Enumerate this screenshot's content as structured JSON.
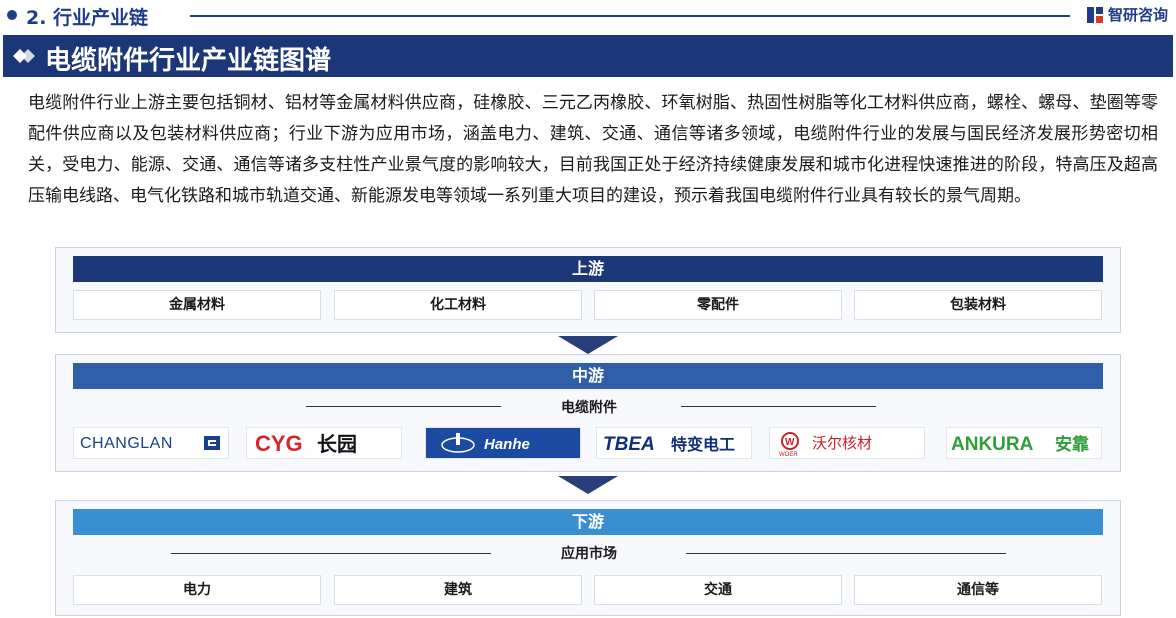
{
  "header": {
    "section": "2. 行业产业链",
    "brand": "智研咨询"
  },
  "title": "电缆附件行业产业链图谱",
  "intro": "电缆附件行业上游主要包括铜材、铝材等金属材料供应商，硅橡胶、三元乙丙橡胶、环氧树脂、热固性树脂等化工材料供应商，螺栓、螺母、垫圈等零配件供应商以及包装材料供应商；行业下游为应用市场，涵盖电力、建筑、交通、通信等诸多领域，电缆附件行业的发展与国民经济发展形势密切相关，受电力、能源、交通、通信等诸多支柱性产业景气度的影响较大，目前我国正处于经济持续健康发展和城市化进程快速推进的阶段，特高压及超高压输电线路、电气化铁路和城市轨道交通、新能源发电等领域一系列重大项目的建设，预示着我国电缆附件行业具有较长的景气周期。",
  "upstream": {
    "label": "上游",
    "items": [
      "金属材料",
      "化工材料",
      "零配件",
      "包装材料"
    ]
  },
  "midstream": {
    "label": "中游",
    "sub": "电缆附件",
    "logos": {
      "changlan": "CHANGLAN",
      "cyg": "CYG",
      "cyg_cn": "长园",
      "hanhe": "Hanhe",
      "tbea": "TBEA",
      "tbea_cn": "特变电工",
      "woer": "WOER",
      "woer_cn": "沃尔核材",
      "ankura": "ANKURA",
      "ankura_cn": "安靠"
    }
  },
  "downstream": {
    "label": "下游",
    "sub": "应用市场",
    "items": [
      "电力",
      "建筑",
      "交通",
      "通信等"
    ]
  },
  "colors": {
    "navy": "#1b3778",
    "mid": "#2f5fa8",
    "light": "#3a8fd0",
    "arrow": "#27407a"
  }
}
